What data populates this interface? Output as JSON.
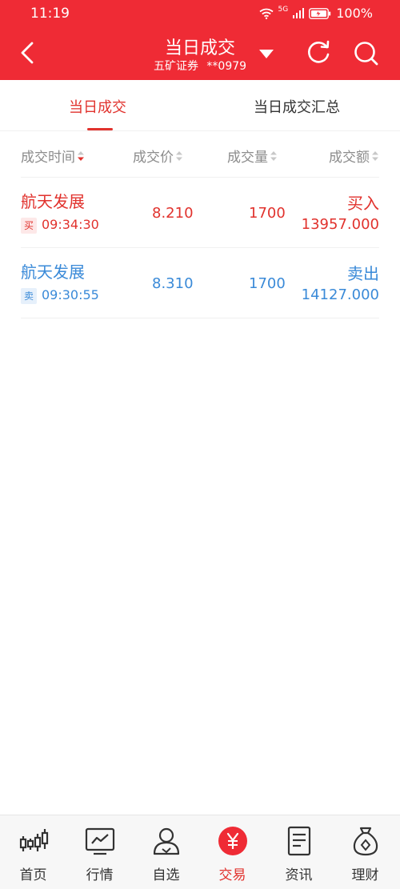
{
  "status_bar": {
    "time": "11:19",
    "battery": "100%",
    "network_label": "5G",
    "text_color": "#ffffff",
    "background": "#ef2b35"
  },
  "nav": {
    "title": "当日成交",
    "subtitle_broker": "五矿证券",
    "subtitle_account": "**0979",
    "back_icon": "chevron-left-icon",
    "dropdown_icon": "triangle-down-icon",
    "refresh_icon": "refresh-icon",
    "search_icon": "search-icon"
  },
  "tabs": [
    {
      "label": "当日成交",
      "active": true
    },
    {
      "label": "当日成交汇总",
      "active": false
    }
  ],
  "columns": [
    {
      "label": "成交时间",
      "sort": "desc"
    },
    {
      "label": "成交价",
      "sort": "none"
    },
    {
      "label": "成交量",
      "sort": "none"
    },
    {
      "label": "成交额",
      "sort": "none"
    }
  ],
  "trades": [
    {
      "name": "航天发展",
      "tag": "买",
      "time": "09:34:30",
      "price": "8.210",
      "quantity": "1700",
      "direction": "买入",
      "amount": "13957.000",
      "color": "#e1322d"
    },
    {
      "name": "航天发展",
      "tag": "卖",
      "time": "09:30:55",
      "price": "8.310",
      "quantity": "1700",
      "direction": "卖出",
      "amount": "14127.000",
      "color": "#3a8ad8"
    }
  ],
  "tabbar": [
    {
      "label": "首页",
      "icon": "candlestick-icon",
      "active": false
    },
    {
      "label": "行情",
      "icon": "chart-line-icon",
      "active": false
    },
    {
      "label": "自选",
      "icon": "user-icon",
      "active": false
    },
    {
      "label": "交易",
      "icon": "yen-icon",
      "active": true
    },
    {
      "label": "资讯",
      "icon": "document-icon",
      "active": false
    },
    {
      "label": "理财",
      "icon": "money-bag-icon",
      "active": false
    }
  ],
  "theme": {
    "accent": "#ef2b35",
    "buy_color": "#e1322d",
    "sell_color": "#3a8ad8"
  }
}
